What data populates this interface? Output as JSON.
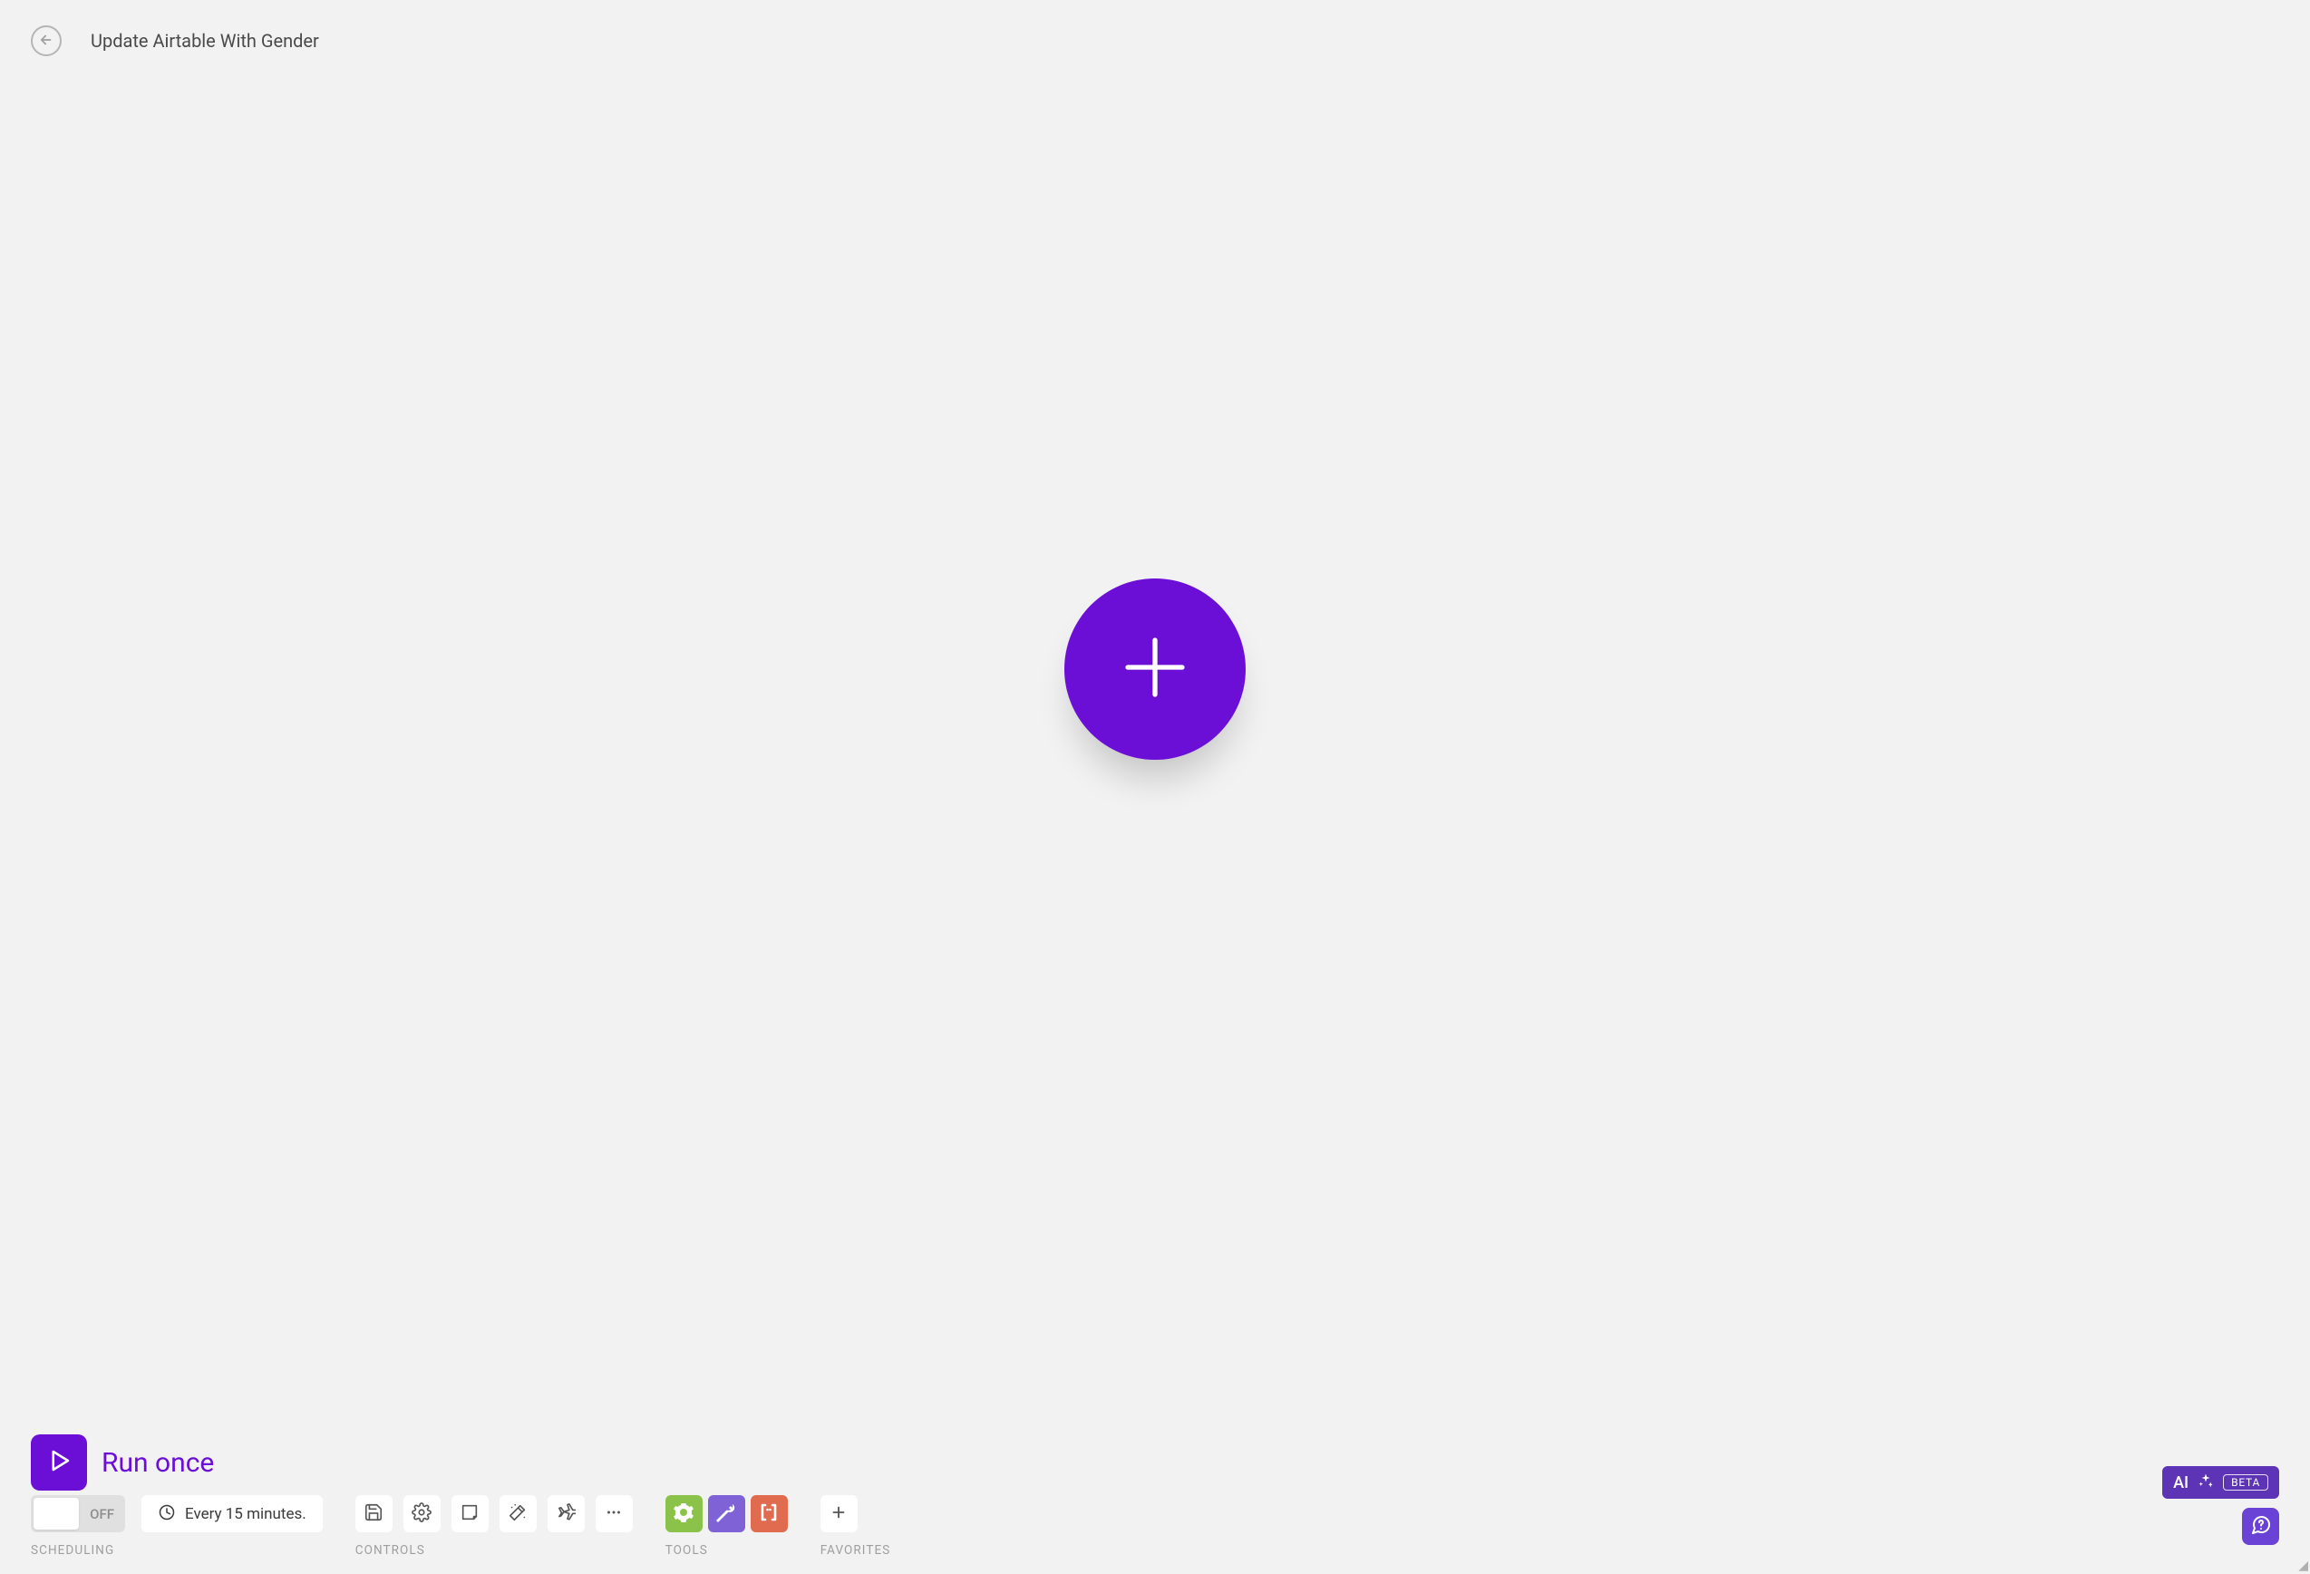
{
  "header": {
    "title": "Update Airtable With Gender"
  },
  "run": {
    "label": "Run once"
  },
  "scheduling": {
    "section_label": "SCHEDULING",
    "toggle_state": "OFF",
    "interval_label": "Every 15 minutes."
  },
  "controls": {
    "section_label": "CONTROLS",
    "items": {
      "save": "save-icon",
      "settings": "gear-icon",
      "notes": "note-icon",
      "autoalign": "wand-icon",
      "explain": "airplane-icon",
      "more": "more-icon"
    }
  },
  "tools": {
    "section_label": "TOOLS",
    "items": {
      "flow_control": "flow-control-tool",
      "tools": "wrench-tool",
      "text_parser": "parser-tool"
    }
  },
  "favorites": {
    "section_label": "FAVORITES"
  },
  "ai": {
    "label": "AI",
    "badge": "BETA"
  },
  "colors": {
    "accent": "#6b0fd6",
    "ai_bg": "#5c34b5",
    "tool_green": "#8bc34a",
    "tool_purple": "#7e62d6",
    "tool_orange": "#e16b4e"
  }
}
